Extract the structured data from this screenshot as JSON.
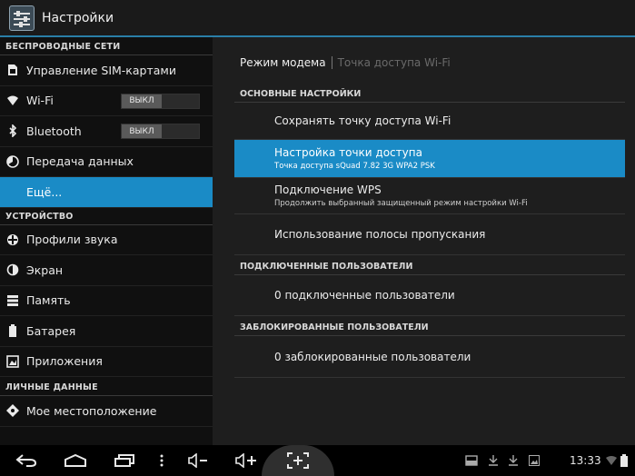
{
  "app": {
    "title": "Настройки"
  },
  "sidebar": {
    "sections": [
      {
        "title": "БЕСПРОВОДНЫЕ СЕТИ"
      },
      {
        "title": "УСТРОЙСТВО"
      },
      {
        "title": "ЛИЧНЫЕ ДАННЫЕ"
      }
    ],
    "items": [
      {
        "label": "Управление SIM-картами",
        "icon": "sim-icon"
      },
      {
        "label": "Wi-Fi",
        "icon": "wifi-icon",
        "toggle": "ВЫКЛ"
      },
      {
        "label": "Bluetooth",
        "icon": "bluetooth-icon",
        "toggle": "ВЫКЛ"
      },
      {
        "label": "Передача данных",
        "icon": "data-usage-icon"
      },
      {
        "label": "Ещё...",
        "selected": true
      },
      {
        "label": "Профили звука",
        "icon": "sound-icon"
      },
      {
        "label": "Экран",
        "icon": "display-icon"
      },
      {
        "label": "Память",
        "icon": "storage-icon"
      },
      {
        "label": "Батарея",
        "icon": "battery-icon"
      },
      {
        "label": "Приложения",
        "icon": "apps-icon"
      },
      {
        "label": "Мое местоположение",
        "icon": "location-icon"
      }
    ]
  },
  "main": {
    "breadcrumb": {
      "active": "Режим модема",
      "inactive": "Точка доступа Wi-Fi"
    },
    "sections": [
      {
        "title": "ОСНОВНЫЕ НАСТРОЙКИ"
      },
      {
        "title": "ПОДКЛЮЧЕННЫЕ ПОЛЬЗОВАТЕЛИ"
      },
      {
        "title": "ЗАБЛОКИРОВАННЫЕ ПОЛЬЗОВАТЕЛИ"
      }
    ],
    "items": [
      {
        "title": "Сохранять точку доступа Wi-Fi"
      },
      {
        "title": "Настройка точки доступа",
        "subtitle": "Точка доступа sQuad 7.82 3G WPA2 PSK",
        "selected": true
      },
      {
        "title": "Подключение WPS",
        "subtitle": "Продолжить выбранный защищенный режим настройки Wi-Fi"
      },
      {
        "title": "Использование полосы пропускания"
      },
      {
        "title": "0 подключенные пользователи"
      },
      {
        "title": "0 заблокированные пользователи"
      }
    ]
  },
  "navbar": {
    "time": "13:33"
  },
  "colors": {
    "accent": "#1a8bc6",
    "background": "#1e1e1e",
    "sidebar": "#101010"
  }
}
